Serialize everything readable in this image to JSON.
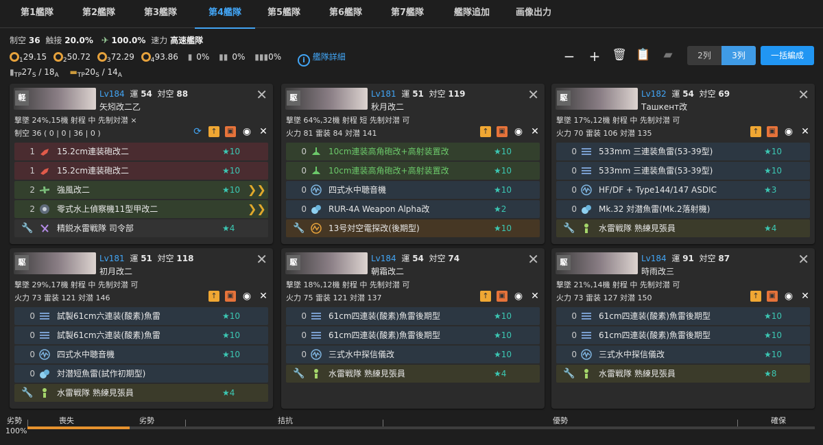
{
  "tabs": [
    "第1艦隊",
    "第2艦隊",
    "第3艦隊",
    "第4艦隊",
    "第5艦隊",
    "第6艦隊",
    "第7艦隊",
    "艦隊追加",
    "画像出力"
  ],
  "active_tab": "第4艦隊",
  "summary": {
    "seiku_label": "制空",
    "seiku": "36",
    "shokusetsu_label": "触接",
    "shokusetsu": "20.0%",
    "cutin_pct": "100.0%",
    "speed_label": "速力",
    "speed": "高速艦隊",
    "airbase": [
      {
        "n": "1",
        "v": "29.15"
      },
      {
        "n": "2",
        "v": "50.72"
      },
      {
        "n": "3",
        "v": "72.29"
      },
      {
        "n": "4",
        "v": "93.86"
      }
    ],
    "drum1": "0%",
    "drum2": "0%",
    "drum3": "0%",
    "detail_link": "艦隊詳細",
    "tp_s": "27",
    "tp_s_sub": "S",
    "tp_a": "/ 18",
    "tp_a_sub": "A",
    "tp2_s": "20",
    "tp2_s_sub": "S",
    "tp2_a": "/ 14",
    "tp2_a_sub": "A",
    "tp_label": "TP"
  },
  "toolbar": {
    "col2": "2列",
    "col3": "3列",
    "bulk": "一括編成"
  },
  "ships": [
    {
      "cls": "軽",
      "lv": "Lv184",
      "luck_label": "運",
      "luck": "54",
      "asw_label": "対空",
      "asw": "88",
      "name": "矢矧改二乙",
      "r1": "撃墜 24%,15機  射程 中  先制対潜 ×",
      "r2": "制空 36 ( 0 | 0 | 36 | 0 )",
      "sync": true,
      "slots": [
        {
          "c": "1",
          "t": "red",
          "i": "gun",
          "n": "15.2cm連装砲改二",
          "m": "★10",
          "chev": ""
        },
        {
          "c": "1",
          "t": "red",
          "i": "gun",
          "n": "15.2cm連装砲改二",
          "m": "★10",
          "chev": ""
        },
        {
          "c": "2",
          "t": "green",
          "i": "plane",
          "n": "強風改二",
          "m": "★10",
          "chev": "❯❯"
        },
        {
          "c": "2",
          "t": "green",
          "i": "recon",
          "n": "零式水上偵察機11型甲改二",
          "m": "",
          "chev": "❯❯"
        },
        {
          "c": "",
          "t": "gray",
          "i": "ex",
          "n": "精鋭水雷戦隊 司令部",
          "m": "★4",
          "chev": ""
        }
      ]
    },
    {
      "cls": "駆",
      "lv": "Lv181",
      "luck_label": "運",
      "luck": "51",
      "asw_label": "対空",
      "asw": "119",
      "name": "秋月改二",
      "r1": "撃墜 64%,32機  射程 短  先制対潜 可",
      "r2": "火力 81  雷装 84  対潜 141",
      "sync": false,
      "slots": [
        {
          "c": "0",
          "t": "green",
          "i": "aagun",
          "n": "10cm連装高角砲改+高射装置改",
          "m": "★10",
          "chev": "",
          "aa": true
        },
        {
          "c": "0",
          "t": "green",
          "i": "aagun",
          "n": "10cm連装高角砲改+高射装置改",
          "m": "★10",
          "chev": "",
          "aa": true
        },
        {
          "c": "0",
          "t": "blue",
          "i": "sonar",
          "n": "四式水中聴音機",
          "m": "★10",
          "chev": ""
        },
        {
          "c": "0",
          "t": "blue",
          "i": "dc",
          "n": "RUR-4A Weapon Alpha改",
          "m": "★2",
          "chev": ""
        },
        {
          "c": "",
          "t": "orange",
          "i": "radar",
          "n": "13号対空電探改(後期型)",
          "m": "★10",
          "chev": ""
        }
      ]
    },
    {
      "cls": "駆",
      "lv": "Lv182",
      "luck_label": "運",
      "luck": "54",
      "asw_label": "対空",
      "asw": "69",
      "name": "Ташкент改",
      "r1": "撃墜 17%,12機  射程 中  先制対潜 可",
      "r2": "火力 70  雷装 106  対潜 135",
      "sync": false,
      "slots": [
        {
          "c": "0",
          "t": "blue",
          "i": "torp",
          "n": "533mm 三連装魚雷(53-39型)",
          "m": "★10",
          "chev": ""
        },
        {
          "c": "0",
          "t": "blue",
          "i": "torp",
          "n": "533mm 三連装魚雷(53-39型)",
          "m": "★10",
          "chev": ""
        },
        {
          "c": "0",
          "t": "blue",
          "i": "sonar",
          "n": "HF/DF + Type144/147 ASDIC",
          "m": "★3",
          "chev": ""
        },
        {
          "c": "0",
          "t": "blue",
          "i": "dc",
          "n": "Mk.32 対潜魚雷(Mk.2落射機)",
          "m": "",
          "chev": ""
        },
        {
          "c": "",
          "t": "olive",
          "i": "crew",
          "n": "水雷戦隊 熟練見張員",
          "m": "★4",
          "chev": ""
        }
      ]
    },
    {
      "cls": "駆",
      "lv": "Lv181",
      "luck_label": "運",
      "luck": "51",
      "asw_label": "対空",
      "asw": "118",
      "name": "初月改二",
      "r1": "撃墜 29%,17機  射程 中  先制対潜 可",
      "r2": "火力 73  雷装 121  対潜 146",
      "sync": false,
      "slots": [
        {
          "c": "0",
          "t": "blue",
          "i": "torp",
          "n": "試製61cm六連装(酸素)魚雷",
          "m": "★10",
          "chev": ""
        },
        {
          "c": "0",
          "t": "blue",
          "i": "torp",
          "n": "試製61cm六連装(酸素)魚雷",
          "m": "★10",
          "chev": ""
        },
        {
          "c": "0",
          "t": "blue",
          "i": "sonar",
          "n": "四式水中聴音機",
          "m": "★10",
          "chev": ""
        },
        {
          "c": "0",
          "t": "blue",
          "i": "dc",
          "n": "対潜短魚雷(試作初期型)",
          "m": "",
          "chev": ""
        },
        {
          "c": "",
          "t": "olive",
          "i": "crew",
          "n": "水雷戦隊 熟練見張員",
          "m": "★4",
          "chev": ""
        }
      ]
    },
    {
      "cls": "駆",
      "lv": "Lv184",
      "luck_label": "運",
      "luck": "54",
      "asw_label": "対空",
      "asw": "74",
      "name": "朝霜改二",
      "r1": "撃墜 18%,12機  射程 中  先制対潜 可",
      "r2": "火力 75  雷装 121  対潜 137",
      "sync": false,
      "slots": [
        {
          "c": "0",
          "t": "blue",
          "i": "torp",
          "n": "61cm四連装(酸素)魚雷後期型",
          "m": "★10",
          "chev": ""
        },
        {
          "c": "0",
          "t": "blue",
          "i": "torp",
          "n": "61cm四連装(酸素)魚雷後期型",
          "m": "★10",
          "chev": ""
        },
        {
          "c": "0",
          "t": "blue",
          "i": "sonar",
          "n": "三式水中探信儀改",
          "m": "★10",
          "chev": ""
        },
        {
          "c": "",
          "t": "olive",
          "i": "crew",
          "n": "水雷戦隊 熟練見張員",
          "m": "★4",
          "chev": ""
        }
      ]
    },
    {
      "cls": "駆",
      "lv": "Lv184",
      "luck_label": "運",
      "luck": "91",
      "asw_label": "対空",
      "asw": "87",
      "name": "時雨改三",
      "r1": "撃墜 21%,14機  射程 中  先制対潜 可",
      "r2": "火力 73  雷装 127  対潜 150",
      "sync": false,
      "slots": [
        {
          "c": "0",
          "t": "blue",
          "i": "torp",
          "n": "61cm四連装(酸素)魚雷後期型",
          "m": "★10",
          "chev": ""
        },
        {
          "c": "0",
          "t": "blue",
          "i": "torp",
          "n": "61cm四連装(酸素)魚雷後期型",
          "m": "★10",
          "chev": ""
        },
        {
          "c": "0",
          "t": "blue",
          "i": "sonar",
          "n": "三式水中探信儀改",
          "m": "★10",
          "chev": ""
        },
        {
          "c": "",
          "t": "olive",
          "i": "crew",
          "n": "水雷戦隊 熟練見張員",
          "m": "★8",
          "chev": ""
        }
      ]
    }
  ],
  "air_state": {
    "left_label": "劣勢",
    "percent_label": "100%",
    "fill_fraction": 0.13,
    "marks": [
      "喪失",
      "劣勢",
      "拮抗",
      "優勢",
      "確保"
    ]
  }
}
